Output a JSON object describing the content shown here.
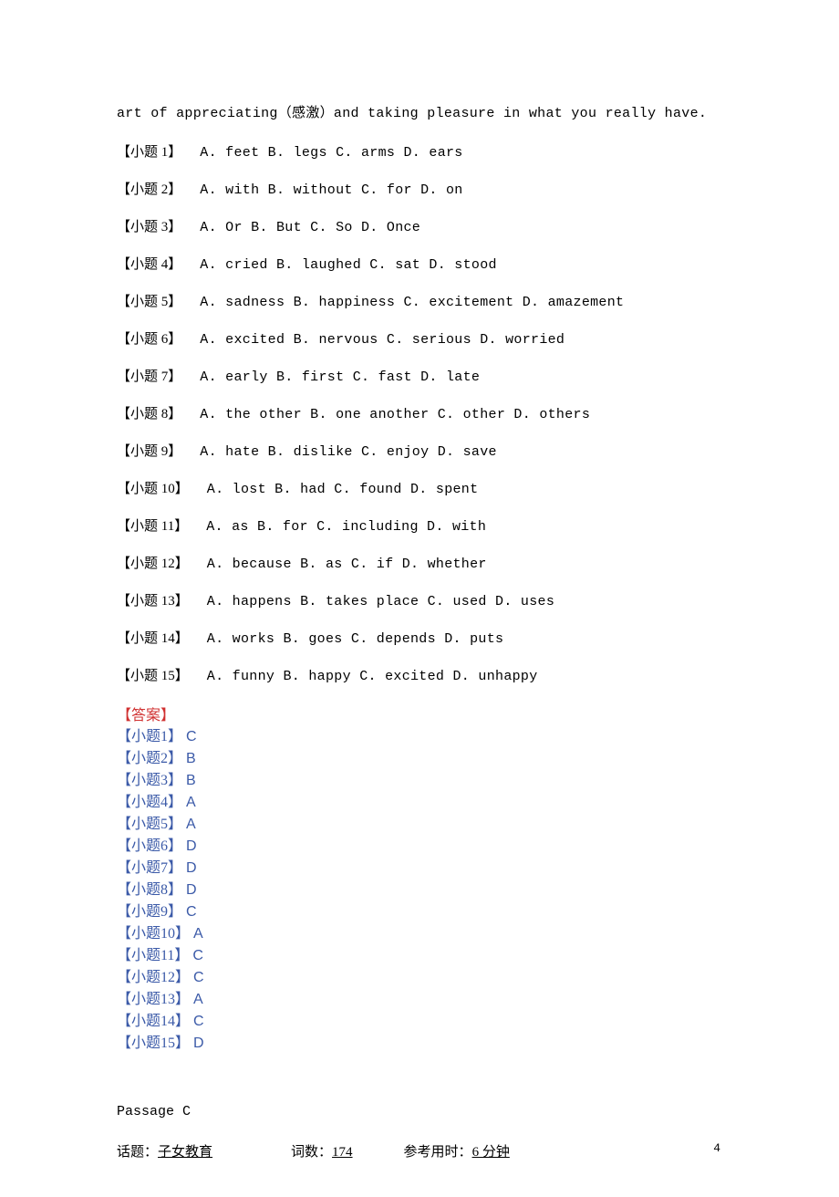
{
  "intro": "art of appreciating（感激）and taking pleasure in what you really have.",
  "questions": [
    {
      "label": "【小题 1】",
      "options": "A. feet B. legs C. arms D. ears"
    },
    {
      "label": "【小题 2】",
      "options": "A. with B. without  C. for  D. on"
    },
    {
      "label": "【小题 3】",
      "options": "A. Or  B. But  C. So  D. Once"
    },
    {
      "label": "【小题 4】",
      "options": "A. cried   B. laughed  C. sat  D. stood"
    },
    {
      "label": "【小题 5】",
      "options": "A. sadness  B. happiness   C. excitement  D. amazement"
    },
    {
      "label": "【小题 6】",
      "options": "A. excited  B. nervous  C. serious  D. worried"
    },
    {
      "label": "【小题 7】",
      "options": "A. early   B. first   C. fast D. late"
    },
    {
      "label": "【小题 8】",
      "options": "A. the other   B. one another  C. other   D. others"
    },
    {
      "label": "【小题 9】",
      "options": "A. hate B. dislike  C. enjoy   D. save"
    },
    {
      "label": "【小题 10】",
      "options": "A. lost B. had  C. found   D. spent"
    },
    {
      "label": "【小题 11】",
      "options": "A. as  B. for  C. including   D. with"
    },
    {
      "label": "【小题 12】",
      "options": "A. because  B. as   C. if  D. whether"
    },
    {
      "label": "【小题 13】",
      "options": "A. happens  B. takes place  C. used D. uses"
    },
    {
      "label": "【小题 14】",
      "options": "A. works   B. goes C. depends  D. puts"
    },
    {
      "label": "【小题 15】",
      "options": "A. funny   B. happy   C. excited  D. unhappy"
    }
  ],
  "answers_header": "【答案】",
  "answers": [
    {
      "label": "【小题1】",
      "letter": "C"
    },
    {
      "label": "【小题2】",
      "letter": "B"
    },
    {
      "label": "【小题3】",
      "letter": "B"
    },
    {
      "label": "【小题4】",
      "letter": "A"
    },
    {
      "label": "【小题5】",
      "letter": "A"
    },
    {
      "label": "【小题6】",
      "letter": "D"
    },
    {
      "label": "【小题7】",
      "letter": "D"
    },
    {
      "label": "【小题8】",
      "letter": "D"
    },
    {
      "label": "【小题9】",
      "letter": "C"
    },
    {
      "label": "【小题10】",
      "letter": "A"
    },
    {
      "label": "【小题11】",
      "letter": "C"
    },
    {
      "label": "【小题12】",
      "letter": "C"
    },
    {
      "label": "【小题13】",
      "letter": "A"
    },
    {
      "label": "【小题14】",
      "letter": "C"
    },
    {
      "label": "【小题15】",
      "letter": "D"
    }
  ],
  "passage_title": "Passage C",
  "meta": {
    "topic_label": "话题：",
    "topic_value": "子女教育",
    "words_label": "词数：",
    "words_value": "174",
    "time_label": "参考用时：",
    "time_value": "6 分钟"
  },
  "page_number": "4"
}
